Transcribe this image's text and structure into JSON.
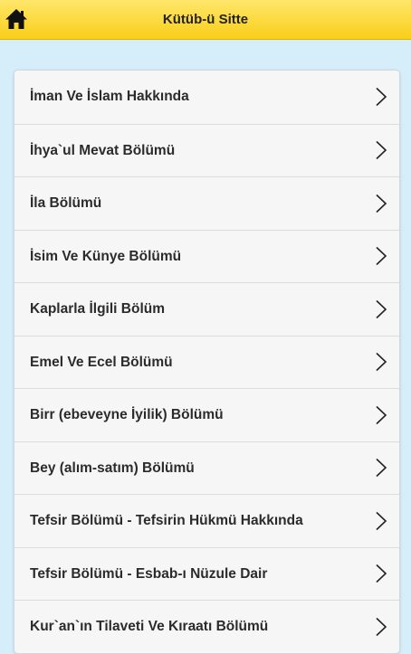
{
  "header": {
    "title": "Kütüb-ü Sitte",
    "home_icon": "home-icon"
  },
  "list": {
    "items": [
      {
        "label": "İman Ve İslam Hakkında"
      },
      {
        "label": "İhya`ul Mevat Bölümü"
      },
      {
        "label": "İla Bölümü"
      },
      {
        "label": "İsim Ve Künye Bölümü"
      },
      {
        "label": "Kaplarla İlgili Bölüm"
      },
      {
        "label": "Emel Ve Ecel Bölümü"
      },
      {
        "label": "Birr (ebeveyne İyilik) Bölümü"
      },
      {
        "label": "Bey (alım-satım) Bölümü"
      },
      {
        "label": "Tefsir Bölümü - Tefsirin Hükmü Hakkında"
      },
      {
        "label": "Tefsir Bölümü - Esbab-ı Nüzule Dair"
      },
      {
        "label": "Kur`an`ın Tilaveti Ve Kıraatı Bölümü"
      }
    ],
    "item_icon": "chevron-right-icon"
  },
  "colors": {
    "header_top": "#ffe66a",
    "header_bottom": "#f9cf19",
    "background": "#d6eefa",
    "list_background": "#f6f6f6"
  }
}
